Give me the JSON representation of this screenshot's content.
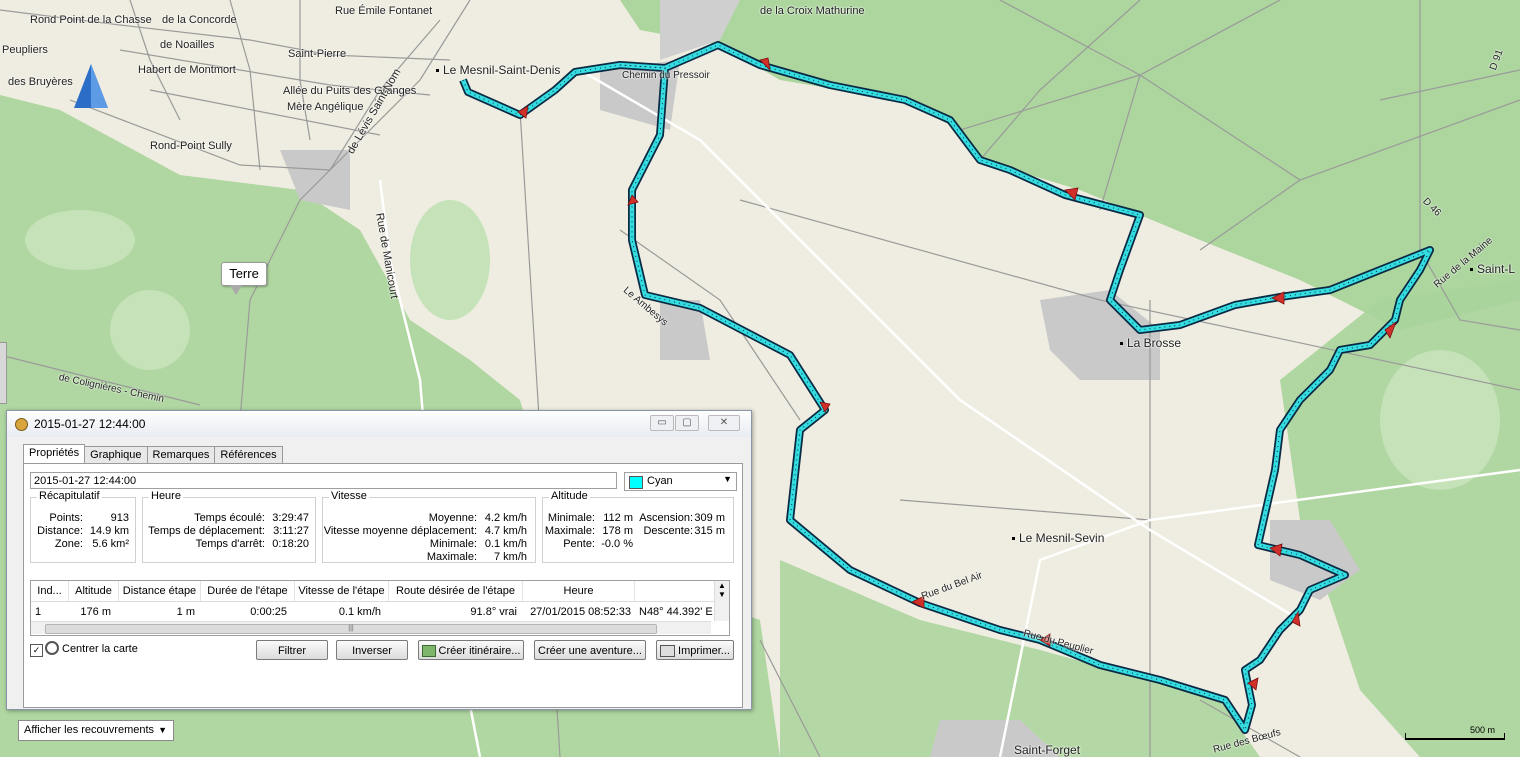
{
  "map": {
    "labels": {
      "rond_point_chasse": "Rond Point de la Chasse",
      "concorde": "de la Concorde",
      "emile_fontanet": "Rue Émile Fontanet",
      "croix_mathurine": "de la Croix Mathurine",
      "noailles": "de Noailles",
      "saint_pierre": "Saint-Pierre",
      "peupliers": "Peupliers",
      "bruyeres": "des Bruyères",
      "habert": "Habert de Montmort",
      "puits_granges": "Allée du Puits des Granges",
      "mere_angelique": "Mère Angélique",
      "rond_point_sully": "Rond-Point Sully",
      "levis_saint_nom": "de Lévis Saint-Nom",
      "manicourt": "Rue de Manicourt",
      "mesnil_saint_denis": "Le Mesnil-Saint-Denis",
      "chemin": "Chemin du Pressoir",
      "ambesys": "Le Ambesys",
      "la_brosse": "La Brosse",
      "mesnil_sevin": "Le Mesnil-Sevin",
      "bel_air": "Rue du Bel Air",
      "saint_forget": "Saint-Forget",
      "saint_l": "Saint-L",
      "rue_maine": "Rue de la Maine",
      "d46": "D 46",
      "d91": "D 91",
      "colignieres": "de Colignières - Chemin",
      "boeufs": "Rue des Bœufs",
      "sap": "Rue du Peuplier"
    },
    "tooltip": "Terre",
    "scale_label": "500 m",
    "track_color": "#00e5e5"
  },
  "dialog": {
    "title": "2015-01-27 12:44:00",
    "window_buttons": [
      "▭",
      "▢",
      "✕"
    ],
    "tabs": [
      "Propriétés",
      "Graphique",
      "Remarques",
      "Références"
    ],
    "name_value": "2015-01-27 12:44:00",
    "color": {
      "label": "Cyan",
      "swatch": "#00ffff"
    },
    "recap": {
      "title": "Récapitulatif",
      "points_label": "Points:",
      "points": "913",
      "distance_label": "Distance:",
      "distance": "14.9 km",
      "zone_label": "Zone:",
      "zone": "5.6 km²"
    },
    "heure": {
      "title": "Heure",
      "ecoule_label": "Temps écoulé:",
      "ecoule": "3:29:47",
      "deplacement_label": "Temps de déplacement:",
      "deplacement": "3:11:27",
      "arret_label": "Temps d'arrêt:",
      "arret": "0:18:20"
    },
    "vitesse": {
      "title": "Vitesse",
      "moyenne_label": "Moyenne:",
      "moyenne": "4.2 km/h",
      "moy_dep_label": "Vitesse moyenne déplacement:",
      "moy_dep": "4.7 km/h",
      "minimale_label": "Minimale:",
      "minimale": "0.1 km/h",
      "maximale_label": "Maximale:",
      "maximale": "7 km/h"
    },
    "altitude": {
      "title": "Altitude",
      "min_label": "Minimale:",
      "min": "112 m",
      "max_label": "Maximale:",
      "max": "178 m",
      "pente_label": "Pente:",
      "pente": "-0.0 %",
      "ascension_label": "Ascension:",
      "ascension": "309 m",
      "descente_label": "Descente:",
      "descente": "315 m"
    },
    "table": {
      "columns": [
        "Ind...",
        "Altitude",
        "Distance étape",
        "Durée de l'étape",
        "Vitesse de l'étape",
        "Route désirée de l'étape",
        "Heure",
        ""
      ],
      "row": [
        "1",
        "176 m",
        "1 m",
        "0:00:25",
        "0.1 km/h",
        "91.8° vrai",
        "27/01/2015 08:52:33",
        "N48° 44.392' E"
      ]
    },
    "center_map_label": "Centrer la carte",
    "buttons": {
      "filtrer": "Filtrer",
      "inverser": "Inverser",
      "itineraire": "Créer itinéraire...",
      "aventure": "Créer une aventure...",
      "imprimer": "Imprimer..."
    }
  },
  "overlay_select": "Afficher les recouvrements"
}
